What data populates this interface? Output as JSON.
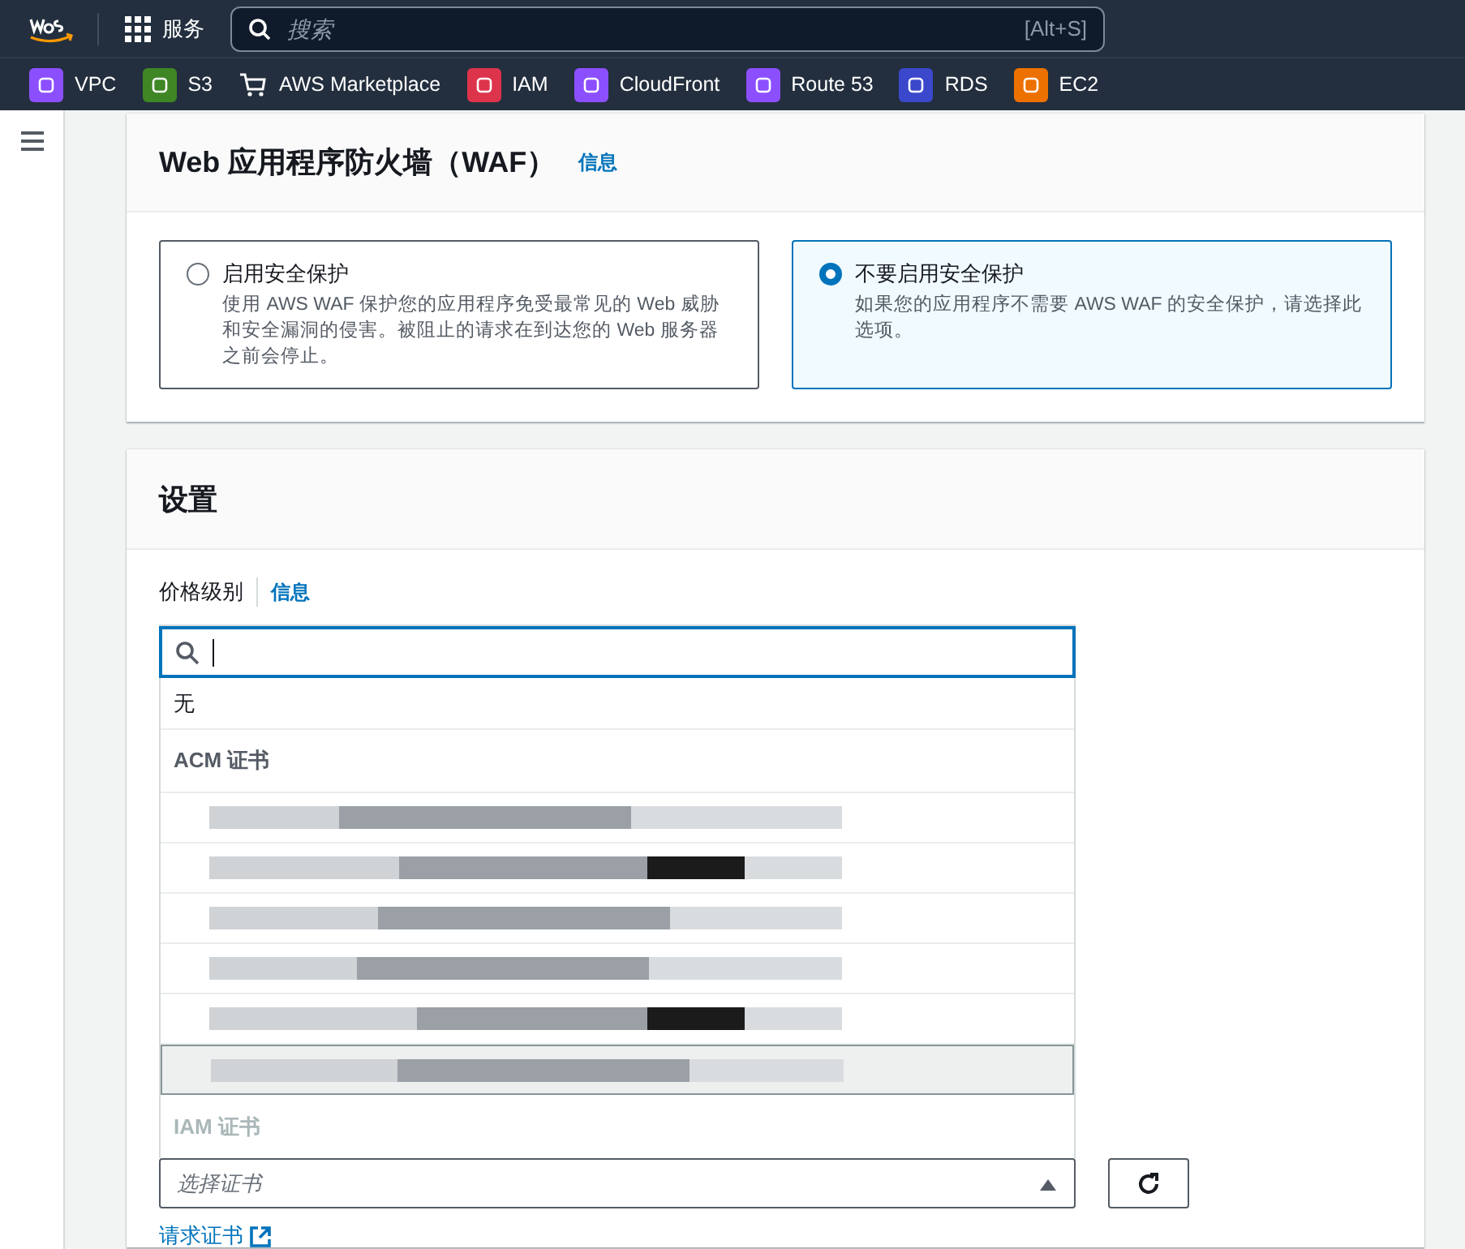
{
  "top_nav": {
    "services_label": "服务",
    "search": {
      "placeholder": "搜索",
      "shortcut": "[Alt+S]"
    }
  },
  "favorites": [
    {
      "label": "VPC",
      "color": "#8c4fff"
    },
    {
      "label": "S3",
      "color": "#3f8624"
    },
    {
      "label": "AWS Marketplace",
      "kind": "cart"
    },
    {
      "label": "IAM",
      "color": "#dd344c"
    },
    {
      "label": "CloudFront",
      "color": "#8c4fff"
    },
    {
      "label": "Route 53",
      "color": "#8c4fff"
    },
    {
      "label": "RDS",
      "color": "#3b48cc"
    },
    {
      "label": "EC2",
      "color": "#ed7100"
    }
  ],
  "waf_panel": {
    "title": "Web 应用程序防火墙（WAF）",
    "info_link": "信息",
    "options": [
      {
        "title": "启用安全保护",
        "description": "使用 AWS WAF 保护您的应用程序免受最常见的 Web 威胁和安全漏洞的侵害。被阻止的请求在到达您的 Web 服务器之前会停止。",
        "selected": false
      },
      {
        "title": "不要启用安全保护",
        "description": "如果您的应用程序不需要 AWS WAF 的安全保护，请选择此选项。",
        "selected": true
      }
    ]
  },
  "settings_panel": {
    "title": "设置",
    "price_class": {
      "label": "价格级别",
      "info_link": "信息"
    },
    "certificate_select": {
      "placeholder": "选择证书",
      "expanded": true,
      "request_link": "请求证书",
      "dropdown": {
        "none_option": "无",
        "groups": [
          {
            "label": "ACM 证书",
            "disabled": false,
            "items": [
              {
                "selected": false
              },
              {
                "selected": false
              },
              {
                "selected": false
              },
              {
                "selected": false
              },
              {
                "selected": false
              },
              {
                "selected": true
              }
            ]
          },
          {
            "label": "IAM 证书",
            "disabled": true
          }
        ]
      }
    }
  }
}
